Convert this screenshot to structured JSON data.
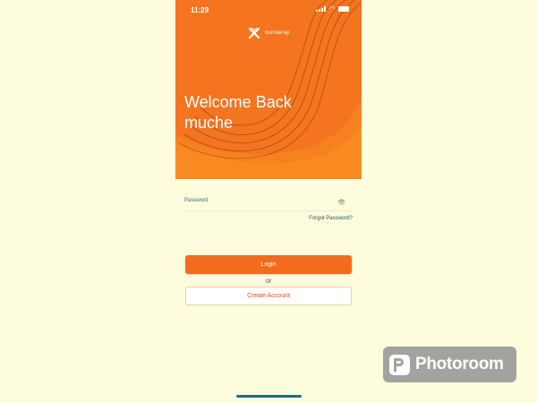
{
  "status_bar": {
    "time": "11:29"
  },
  "brand": {
    "name": "BonitaPay"
  },
  "hero": {
    "welcome_line1": "Welcome Back",
    "welcome_line2": "muche",
    "color": "#f47420"
  },
  "form": {
    "password_label": "Password",
    "forgot_password": "Forgot Password?"
  },
  "actions": {
    "login_label": "Login",
    "or_label": "or",
    "create_account_label": "Create Account"
  },
  "watermark": {
    "text": "Photoroom"
  },
  "icons": [
    "signal-icon",
    "wifi-icon",
    "battery-icon",
    "brand-logo-icon",
    "eye-icon",
    "photoroom-logo-icon"
  ]
}
